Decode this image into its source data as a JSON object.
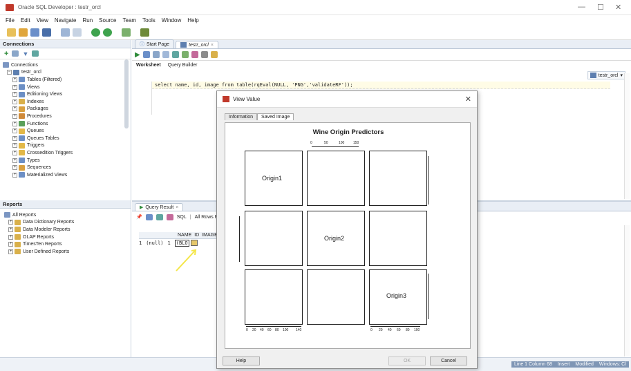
{
  "window": {
    "title": "Oracle SQL Developer : testr_orcl"
  },
  "menu": [
    "File",
    "Edit",
    "View",
    "Navigate",
    "Run",
    "Source",
    "Team",
    "Tools",
    "Window",
    "Help"
  ],
  "connections": {
    "title": "Connections",
    "root_label": "Connections",
    "connection": "testr_orcl",
    "items": [
      "Tables (Filtered)",
      "Views",
      "Editioning Views",
      "Indexes",
      "Packages",
      "Procedures",
      "Functions",
      "Queues",
      "Queues Tables",
      "Triggers",
      "Crossedition Triggers",
      "Types",
      "Sequences",
      "Materialized Views"
    ]
  },
  "reports": {
    "title": "Reports",
    "items": [
      "All Reports",
      "Data Dictionary Reports",
      "Data Modeler Reports",
      "OLAP Reports",
      "TimesTen Reports",
      "User Defined Reports"
    ]
  },
  "editor": {
    "tabs": [
      "Start Page",
      "testr_orcl"
    ],
    "subtabs": [
      "Worksheet",
      "Query Builder"
    ],
    "sql": "select name, id, image from table(rqEval(NULL, 'PNG','validateRF'));",
    "connection_selector": "testr_orcl"
  },
  "query_result": {
    "tab": "Query Result",
    "sql_label": "SQL",
    "rows_label": "All Rows F",
    "columns": [
      "NAME",
      "ID",
      "IMAGE"
    ],
    "row": {
      "num": "1",
      "name": "(null)",
      "id": "1",
      "image": "(BLO"
    }
  },
  "dialog": {
    "title": "View Value",
    "tabs": [
      "Information",
      "Saved Image"
    ],
    "plot_title": "Wine Origin Predictors",
    "labels": [
      "Origin1",
      "Origin2",
      "Origin3"
    ],
    "top_axis": [
      "0",
      "50",
      "100",
      "150"
    ],
    "bottom_axis": [
      "0",
      "20",
      "40",
      "60",
      "80",
      "100",
      "140"
    ],
    "bottom_axis2": [
      "0",
      "20",
      "40",
      "60",
      "80",
      "100"
    ],
    "buttons": {
      "help": "Help",
      "ok": "OK",
      "cancel": "Cancel"
    }
  },
  "status": {
    "line_col": "Line 1 Column 68",
    "mode": "Insert",
    "modified": "Modified",
    "os": "Windows: Cl"
  }
}
